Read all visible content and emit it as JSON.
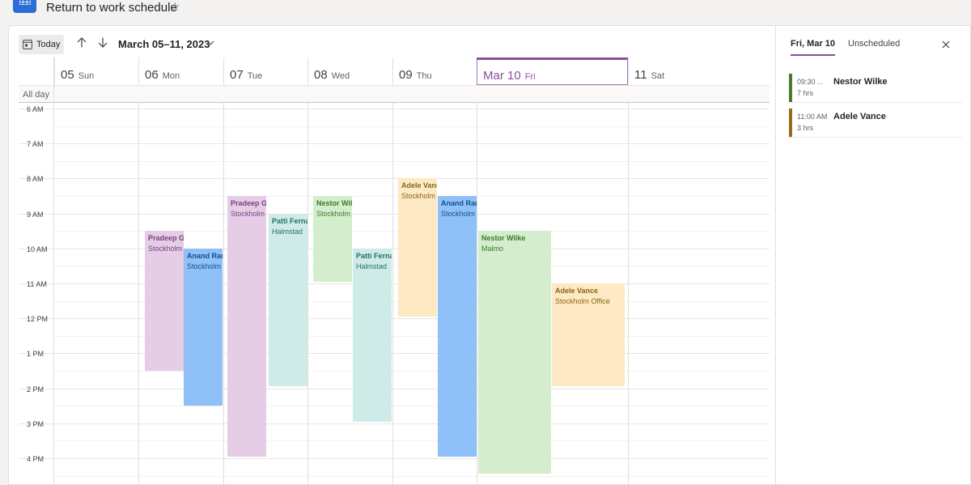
{
  "app": {
    "title": "Return to work schedule",
    "star_icon": "star-outline-icon"
  },
  "toolbar": {
    "today_label": "Today",
    "range_label": "March 05–11, 2023"
  },
  "calendar": {
    "allday_label": "All day",
    "days": [
      {
        "num": "05",
        "dow": "Sun"
      },
      {
        "num": "06",
        "dow": "Mon"
      },
      {
        "num": "07",
        "dow": "Tue"
      },
      {
        "num": "08",
        "dow": "Wed"
      },
      {
        "num": "09",
        "dow": "Thu"
      },
      {
        "num": "Mar 10",
        "dow": "Fri",
        "current": true
      },
      {
        "num": "11",
        "dow": "Sat"
      }
    ],
    "hours": [
      "6 AM",
      "7 AM",
      "8 AM",
      "9 AM",
      "10 AM",
      "11 AM",
      "12 PM",
      "1 PM",
      "2 PM",
      "3 PM",
      "4 PM"
    ],
    "events": [
      {
        "day": 1,
        "lane": 0,
        "name": "Pradeep Gupta",
        "location": "Stockholm Office",
        "start": 9.5,
        "end": 13.5,
        "bg": "#e4cde5",
        "fg": "#7a3f83"
      },
      {
        "day": 1,
        "lane": 1,
        "name": "Anand Raman",
        "location": "Stockholm Office",
        "start": 10.0,
        "end": 14.5,
        "bg": "#8fc1f8",
        "fg": "#154d8a"
      },
      {
        "day": 2,
        "lane": 0,
        "name": "Pradeep Gupta",
        "location": "Stockholm Office",
        "start": 8.5,
        "end": 15.95,
        "bg": "#e4cde5",
        "fg": "#7a3f83"
      },
      {
        "day": 2,
        "lane": 1,
        "name": "Patti Fernandez",
        "location": "Halmstad",
        "start": 9.0,
        "end": 13.95,
        "bg": "#cfebe7",
        "fg": "#1e7368"
      },
      {
        "day": 3,
        "lane": 0,
        "name": "Nestor Wilke",
        "location": "Stockholm Office",
        "start": 8.5,
        "end": 10.95,
        "bg": "#d4edcd",
        "fg": "#3b7a2b"
      },
      {
        "day": 3,
        "lane": 1,
        "name": "Patti Fernandez",
        "location": "Halmstad",
        "start": 10.0,
        "end": 14.95,
        "bg": "#cfebe7",
        "fg": "#1e7368"
      },
      {
        "day": 4,
        "lane": 0,
        "name": "Adele Vance",
        "location": "Stockholm Office",
        "start": 8.0,
        "end": 11.95,
        "bg": "#fde9c3",
        "fg": "#8a6516"
      },
      {
        "day": 4,
        "lane": 1,
        "name": "Anand Raman",
        "location": "Stockholm Office",
        "start": 8.5,
        "end": 15.95,
        "bg": "#8fc1f8",
        "fg": "#154d8a"
      },
      {
        "day": 5,
        "lane": 0,
        "name": "Nestor Wilke",
        "location": "Malmo",
        "start": 9.5,
        "end": 16.45,
        "bg": "#d4edcd",
        "fg": "#3b7a2b"
      },
      {
        "day": 5,
        "lane": 1,
        "name": "Adele Vance",
        "location": "Stockholm Office",
        "start": 11.0,
        "end": 13.95,
        "bg": "#fde9c3",
        "fg": "#8a6516"
      }
    ]
  },
  "sidepanel": {
    "tabs": [
      {
        "label": "Fri, Mar 10",
        "active": true
      },
      {
        "label": "Unscheduled",
        "active": false
      }
    ],
    "items": [
      {
        "time": "09:30 ...",
        "name": "Nestor Wilke",
        "duration": "7 hrs",
        "color": "#4e7a2a"
      },
      {
        "time": "11:00 AM",
        "name": "Adele Vance",
        "duration": "3 hrs",
        "color": "#9a6b1e"
      }
    ]
  }
}
